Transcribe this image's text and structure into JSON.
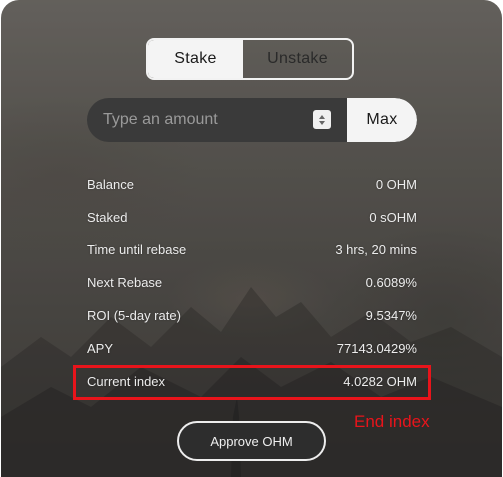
{
  "toggle": {
    "stake_label": "Stake",
    "unstake_label": "Unstake",
    "active": "Stake"
  },
  "amount": {
    "placeholder": "Type an amount",
    "value": "",
    "max_label": "Max"
  },
  "stats": [
    {
      "label": "Balance",
      "value": "0 OHM"
    },
    {
      "label": "Staked",
      "value": "0 sOHM"
    },
    {
      "label": "Time until rebase",
      "value": "3 hrs, 20 mins"
    },
    {
      "label": "Next Rebase",
      "value": "0.6089%"
    },
    {
      "label": "ROI (5-day rate)",
      "value": "9.5347%"
    },
    {
      "label": "APY",
      "value": "77143.0429%"
    },
    {
      "label": "Current index",
      "value": "4.0282 OHM"
    }
  ],
  "annotation": {
    "text": "End index",
    "color": "#e8141b"
  },
  "approve_label": "Approve OHM"
}
